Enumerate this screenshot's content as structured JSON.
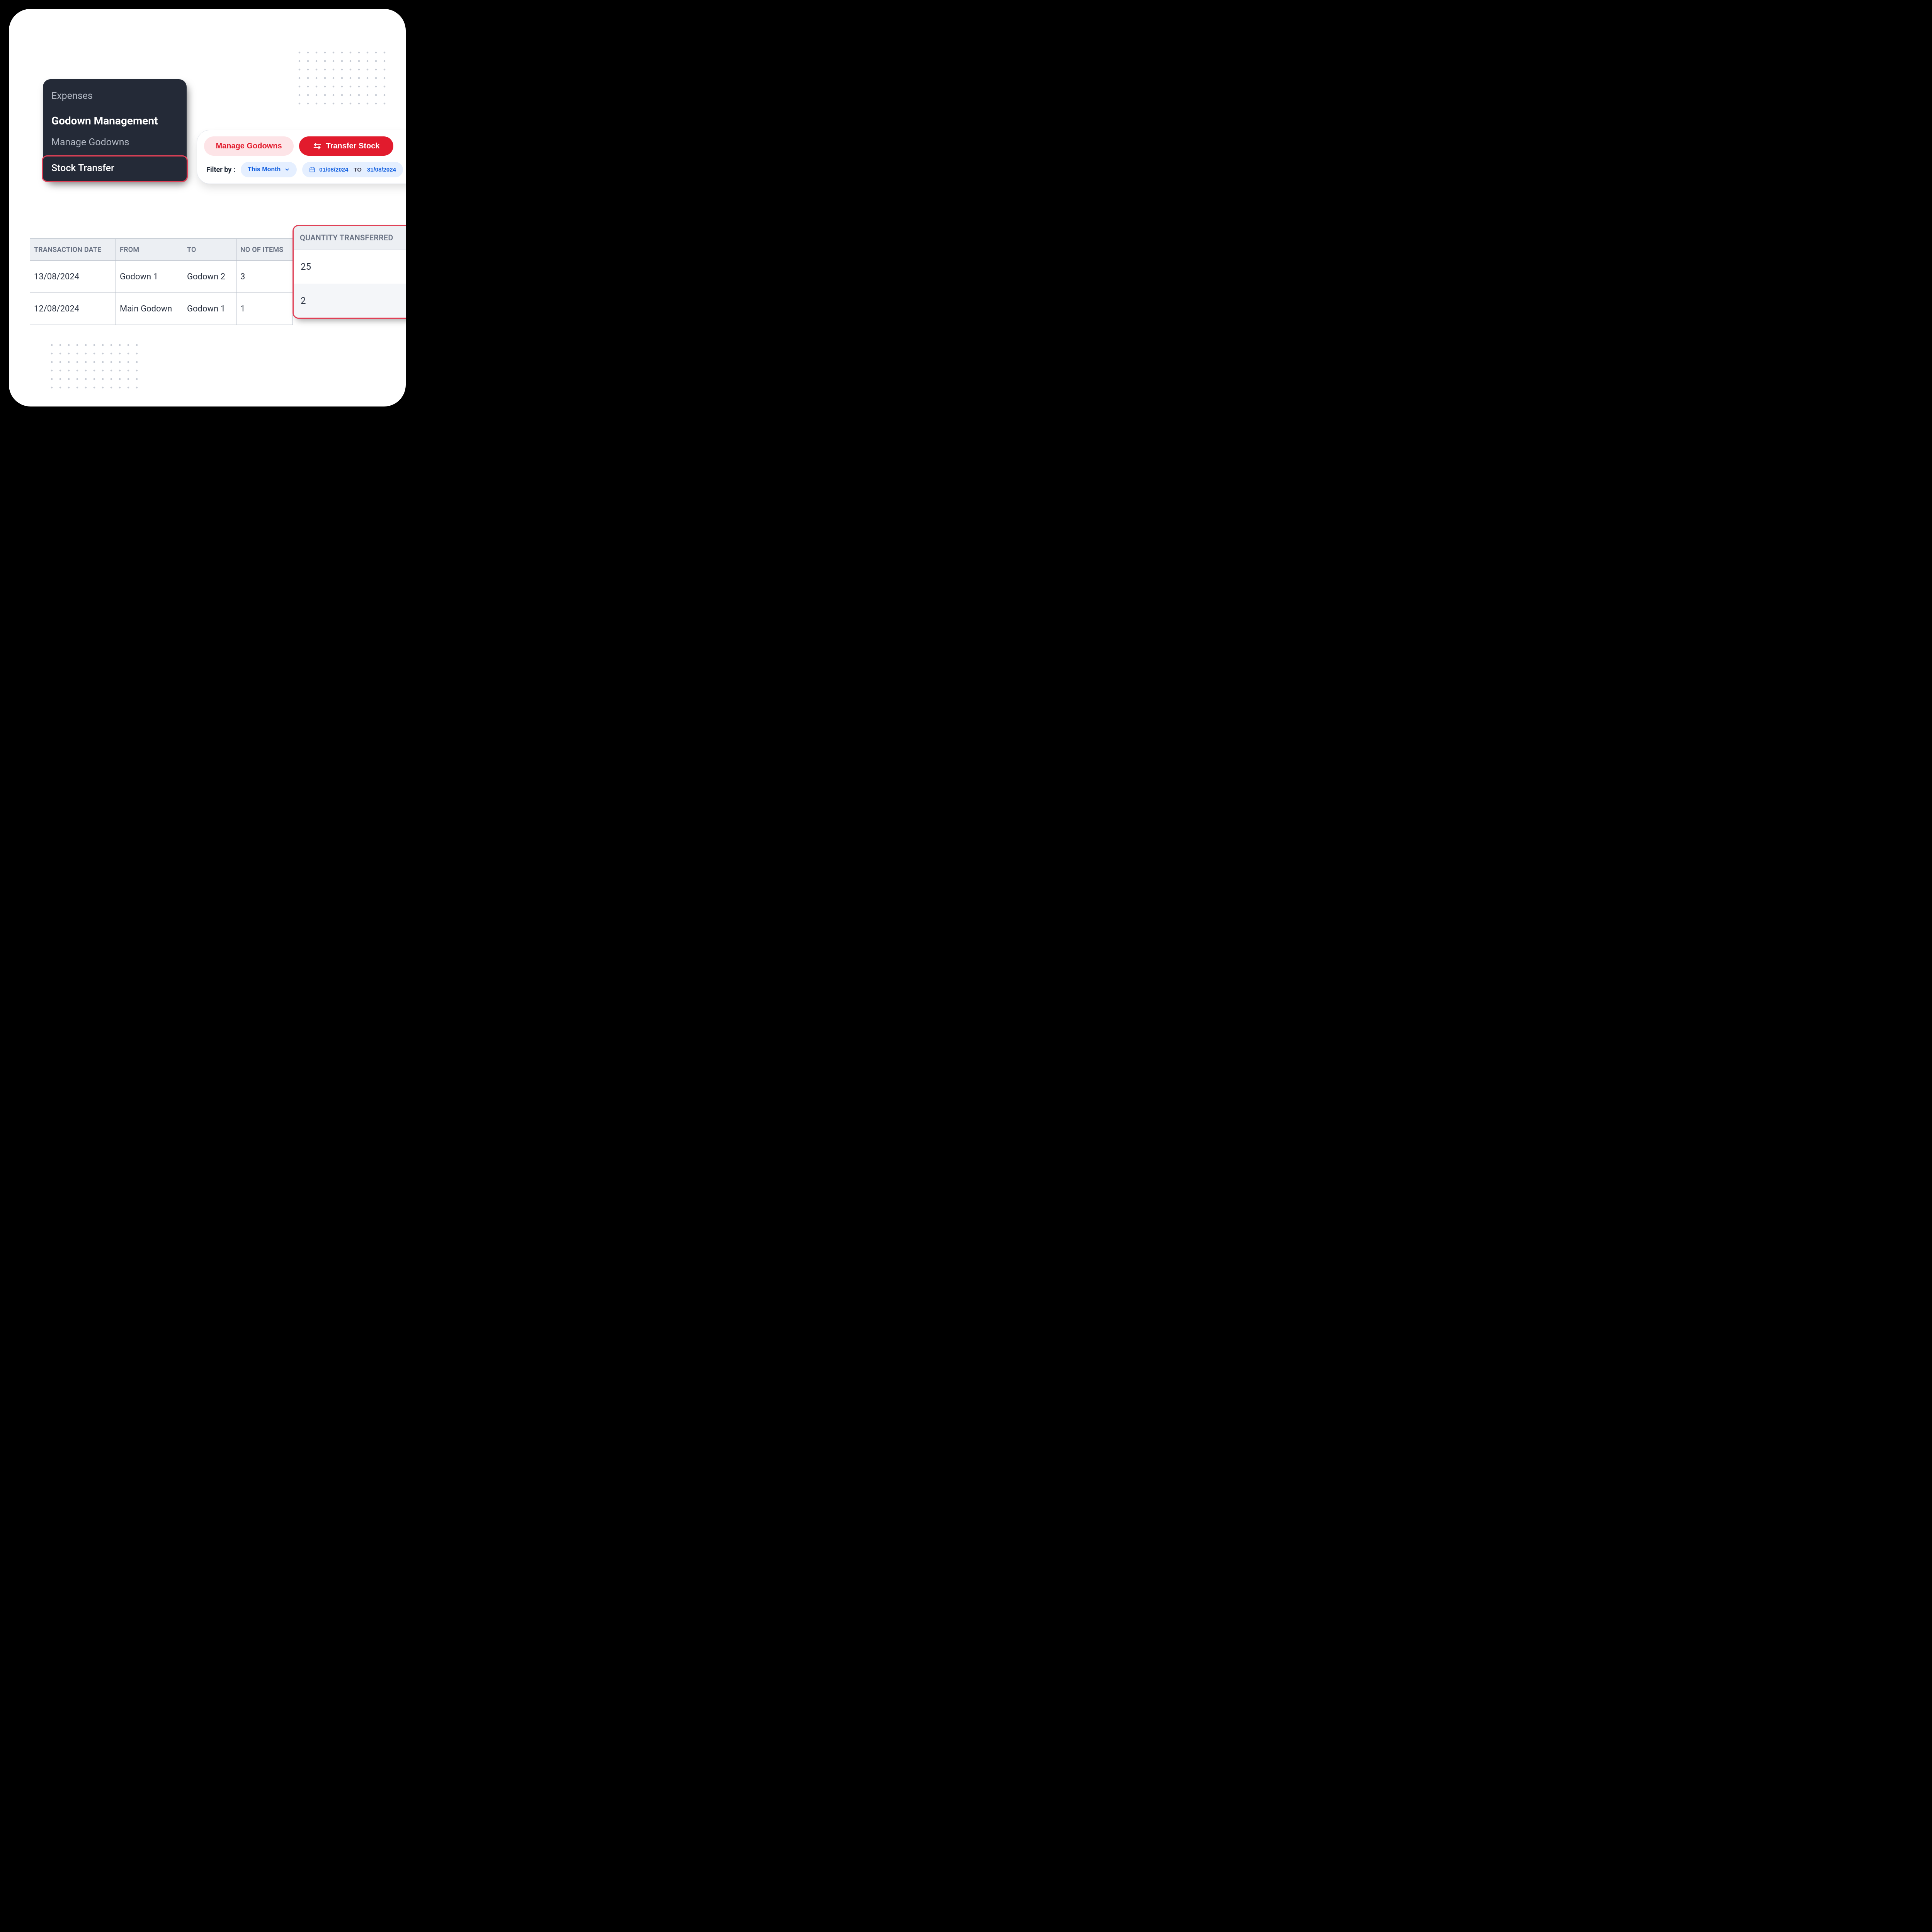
{
  "sidebar": {
    "items": [
      {
        "label": "Expenses",
        "kind": "item"
      },
      {
        "label": "Godown Management",
        "kind": "section"
      },
      {
        "label": "Manage Godowns",
        "kind": "item"
      },
      {
        "label": "Stock Transfer",
        "kind": "active"
      }
    ]
  },
  "toolbar": {
    "manage_label": "Manage Godowns",
    "transfer_label": "Transfer Stock",
    "filter_label": "Filter by :",
    "period": "This Month",
    "date_from": "01/08/2024",
    "date_to_sep": "TO",
    "date_to": "31/08/2024"
  },
  "table": {
    "headers": {
      "date": "TRANSACTION DATE",
      "from": "FROM",
      "to": "TO",
      "items": "NO OF ITEMS",
      "qty": "QUANTITY TRANSFERRED"
    },
    "rows": [
      {
        "date": "13/08/2024",
        "from": "Godown 1",
        "to": "Godown 2",
        "items": "3",
        "qty": "25"
      },
      {
        "date": "12/08/2024",
        "from": "Main Godown",
        "to": "Godown 1",
        "items": "1",
        "qty": "2"
      }
    ]
  }
}
